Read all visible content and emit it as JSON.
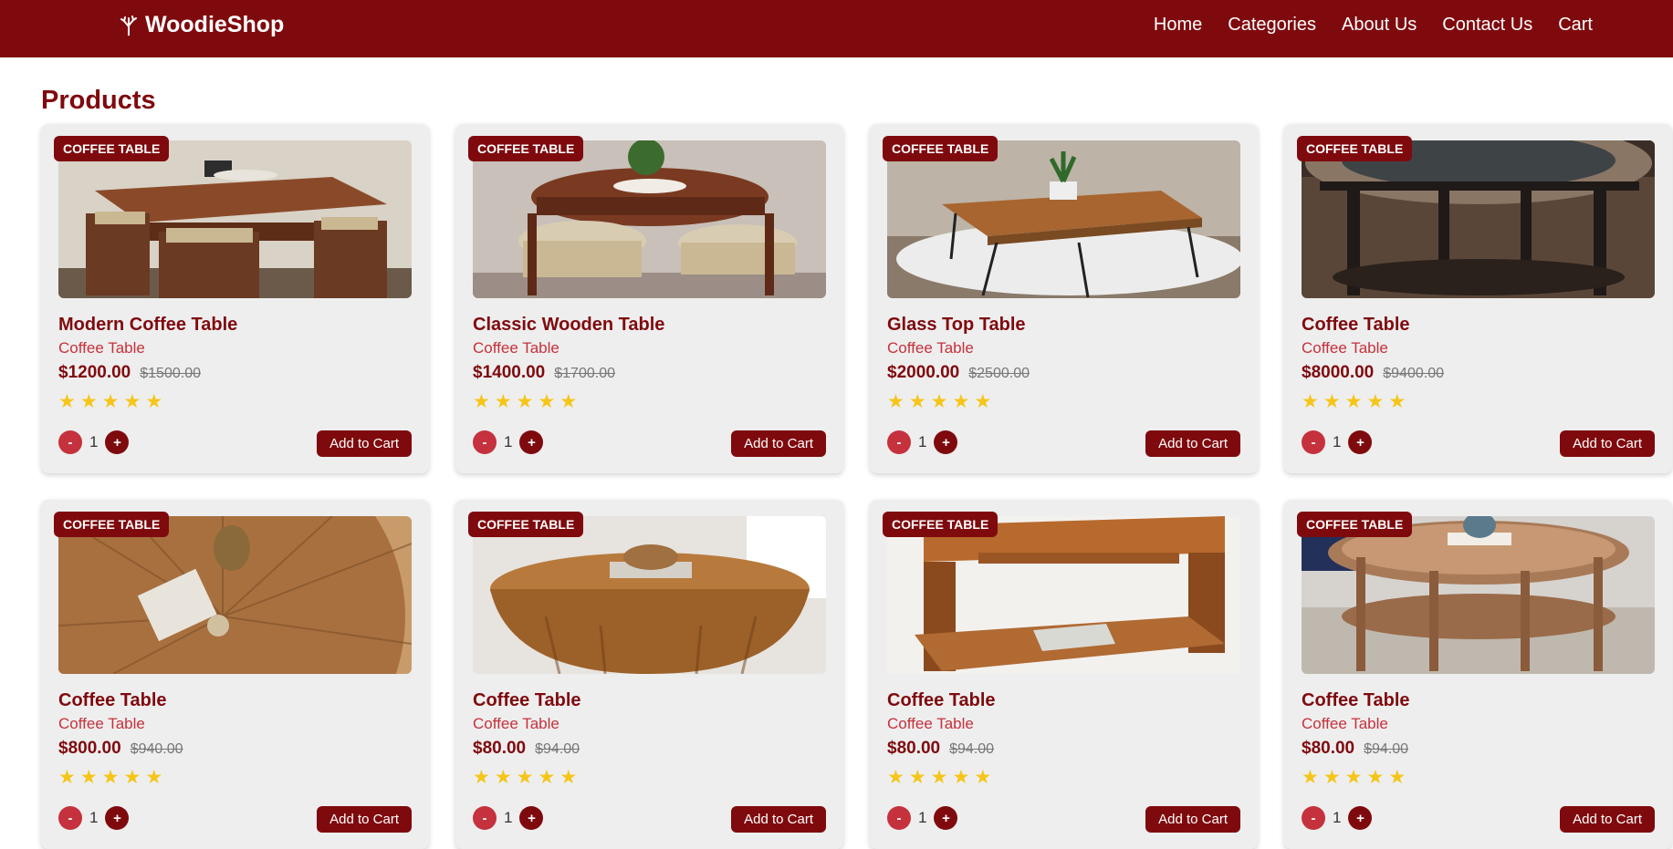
{
  "brand": {
    "name": "WoodieShop",
    "icon": "tree-icon"
  },
  "nav": [
    {
      "label": "Home"
    },
    {
      "label": "Categories"
    },
    {
      "label": "About Us"
    },
    {
      "label": "Contact Us"
    },
    {
      "label": "Cart"
    }
  ],
  "page": {
    "title": "Products"
  },
  "colors": {
    "primary": "#7f0a0e",
    "secondary": "#c5313c",
    "star": "#f5c518",
    "card": "#eeeeee"
  },
  "products": [
    {
      "badge": "COFFEE TABLE",
      "name": "Modern Coffee Table",
      "category": "Coffee Table",
      "price": "$1200.00",
      "old_price": "$1500.00",
      "rating": 5,
      "quantity": "1",
      "minus": "-",
      "plus": "+",
      "add": "Add to Cart",
      "image": "square-table-with-stools"
    },
    {
      "badge": "COFFEE TABLE",
      "name": "Classic Wooden Table",
      "category": "Coffee Table",
      "price": "$1400.00",
      "old_price": "$1700.00",
      "rating": 5,
      "quantity": "1",
      "minus": "-",
      "plus": "+",
      "add": "Add to Cart",
      "image": "round-table-with-stools"
    },
    {
      "badge": "COFFEE TABLE",
      "name": "Glass Top Table",
      "category": "Coffee Table",
      "price": "$2000.00",
      "old_price": "$2500.00",
      "rating": 5,
      "quantity": "1",
      "minus": "-",
      "plus": "+",
      "add": "Add to Cart",
      "image": "hairpin-leg-table"
    },
    {
      "badge": "COFFEE TABLE",
      "name": "Coffee Table",
      "category": "Coffee Table",
      "price": "$8000.00",
      "old_price": "$9400.00",
      "rating": 5,
      "quantity": "1",
      "minus": "-",
      "plus": "+",
      "add": "Add to Cart",
      "image": "dark-round-glass-table"
    },
    {
      "badge": "COFFEE TABLE",
      "name": "Coffee Table",
      "category": "Coffee Table",
      "price": "$800.00",
      "old_price": "$940.00",
      "rating": 5,
      "quantity": "1",
      "minus": "-",
      "plus": "+",
      "add": "Add to Cart",
      "image": "round-sunburst-table-top"
    },
    {
      "badge": "COFFEE TABLE",
      "name": "Coffee Table",
      "category": "Coffee Table",
      "price": "$80.00",
      "old_price": "$94.00",
      "rating": 5,
      "quantity": "1",
      "minus": "-",
      "plus": "+",
      "add": "Add to Cart",
      "image": "drum-table"
    },
    {
      "badge": "COFFEE TABLE",
      "name": "Coffee Table",
      "category": "Coffee Table",
      "price": "$80.00",
      "old_price": "$94.00",
      "rating": 5,
      "quantity": "1",
      "minus": "-",
      "plus": "+",
      "add": "Add to Cart",
      "image": "rectangular-shelf-table"
    },
    {
      "badge": "COFFEE TABLE",
      "name": "Coffee Table",
      "category": "Coffee Table",
      "price": "$80.00",
      "old_price": "$94.00",
      "rating": 5,
      "quantity": "1",
      "minus": "-",
      "plus": "+",
      "add": "Add to Cart",
      "image": "round-two-tier-table"
    }
  ]
}
